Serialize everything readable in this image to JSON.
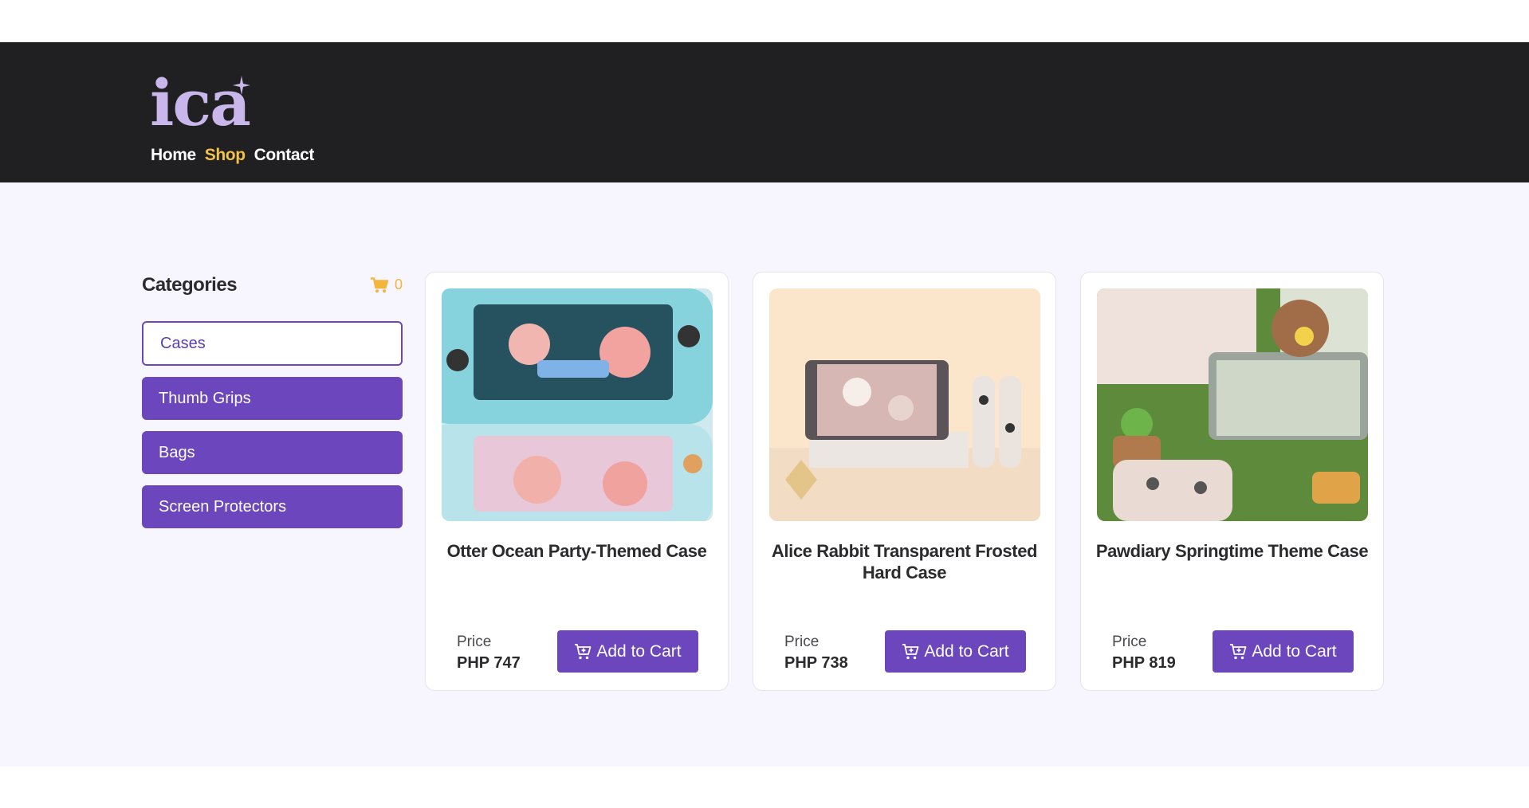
{
  "brand": {
    "logo_text": "ica"
  },
  "nav": {
    "items": [
      {
        "label": "Home",
        "active": false
      },
      {
        "label": "Shop",
        "active": true
      },
      {
        "label": "Contact",
        "active": false
      }
    ]
  },
  "sidebar": {
    "title": "Categories",
    "cart_icon": "cart-icon",
    "cart_count": "0",
    "categories": [
      {
        "label": "Cases",
        "selected": true
      },
      {
        "label": "Thumb Grips",
        "selected": false
      },
      {
        "label": "Bags",
        "selected": false
      },
      {
        "label": "Screen Protectors",
        "selected": false
      }
    ]
  },
  "products": [
    {
      "title": "Otter Ocean Party-Themed Case",
      "price_label": "Price",
      "price": "PHP 747",
      "button_label": "Add to Cart",
      "image_theme": "pastel blue otter console case"
    },
    {
      "title": "Alice Rabbit Transparent Frosted Hard Case",
      "price_label": "Price",
      "price": "PHP 738",
      "button_label": "Add to Cart",
      "image_theme": "peach background clear console case"
    },
    {
      "title": "Pawdiary Springtime Theme Case",
      "price_label": "Price",
      "price": "PHP 819",
      "button_label": "Add to Cart",
      "image_theme": "grass scene pink console case"
    }
  ],
  "colors": {
    "header_bg": "#201f21",
    "accent_purple": "#6b46bd",
    "nav_active": "#f3c248",
    "page_bg": "#f7f5fd",
    "logo": "#c9b6ea"
  }
}
